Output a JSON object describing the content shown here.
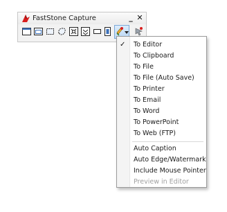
{
  "window": {
    "title": "FastStone Capture"
  },
  "title_buttons": {
    "minimize": "_",
    "close": "✕"
  },
  "menu": {
    "items": [
      {
        "label": "To Editor",
        "checked": true
      },
      {
        "label": "To Clipboard"
      },
      {
        "label": "To File"
      },
      {
        "label": "To File (Auto Save)"
      },
      {
        "label": "To Printer"
      },
      {
        "label": "To Email"
      },
      {
        "label": "To Word"
      },
      {
        "label": "To PowerPoint"
      },
      {
        "label": "To Web (FTP)"
      }
    ],
    "options": [
      {
        "label": "Auto Caption"
      },
      {
        "label": "Auto Edge/Watermark"
      },
      {
        "label": "Include Mouse Pointer"
      },
      {
        "label": "Preview in Editor",
        "disabled": true
      }
    ],
    "check_glyph": "✓"
  },
  "colors": {
    "accent": "#3a7bd5",
    "app_icon_red": "#d81e1e"
  }
}
